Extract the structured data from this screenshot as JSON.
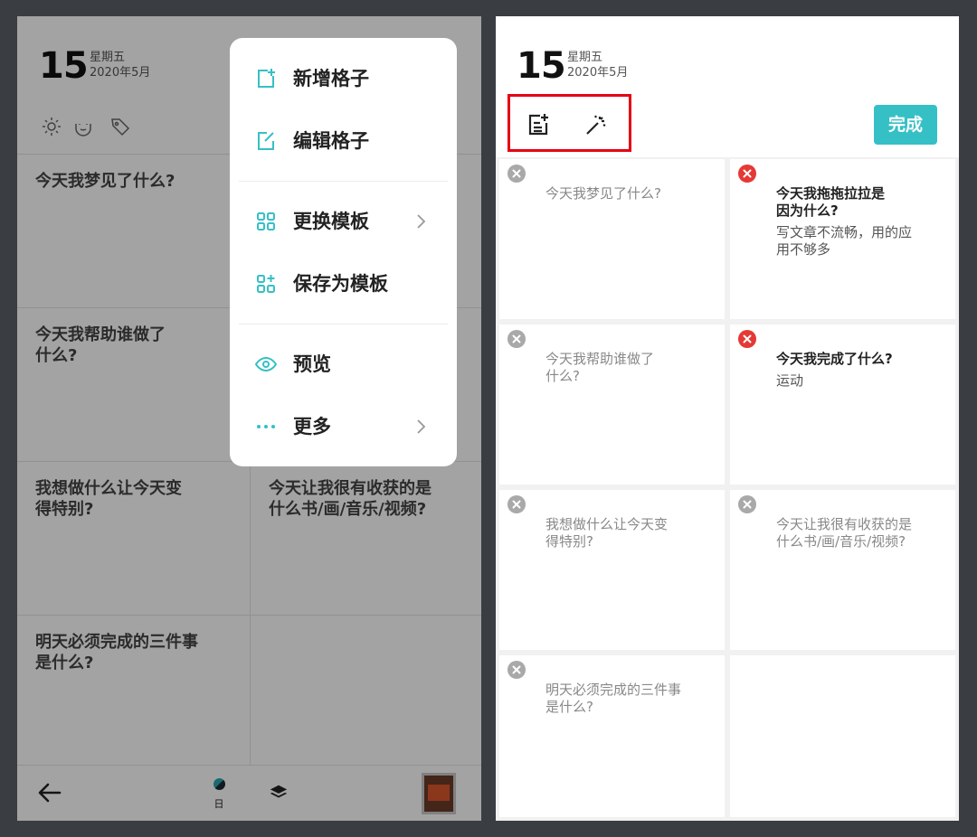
{
  "date": {
    "day": "15",
    "weekday": "星期五",
    "year_month": "2020年5月"
  },
  "left_panel": {
    "header_icons": [
      "sun-icon",
      "mood-icon",
      "tag-icon"
    ],
    "cells": [
      {
        "question_line1": "今天我梦见了什么?",
        "question_line2": ""
      },
      {
        "question_line1": "",
        "question_line2": ""
      },
      {
        "question_line1": "今天我帮助谁做了",
        "question_line2": "什么?"
      },
      {
        "question_line1": "",
        "question_line2": ""
      },
      {
        "question_line1": "我想做什么让今天变",
        "question_line2": "得特别?"
      },
      {
        "question_line1": "今天让我很有收获的是",
        "question_line2": "什么书/画/音乐/视频?"
      },
      {
        "question_line1": "明天必须完成的三件事",
        "question_line2": "是什么?"
      },
      {
        "question_line1": "",
        "question_line2": ""
      }
    ],
    "bottom_bar": {
      "back_icon": "arrow-left-icon",
      "day_label": "日",
      "layers_icon": "layers-icon"
    },
    "menu": {
      "items": [
        {
          "label": "新增格子",
          "icon": "add-cell-icon",
          "has_submenu": false
        },
        {
          "label": "编辑格子",
          "icon": "edit-cell-icon",
          "has_submenu": false
        },
        {
          "label": "更换模板",
          "icon": "template-grid-icon",
          "has_submenu": true
        },
        {
          "label": "保存为模板",
          "icon": "save-template-icon",
          "has_submenu": true
        },
        {
          "label": "预览",
          "icon": "eye-icon",
          "has_submenu": false
        },
        {
          "label": "更多",
          "icon": "more-dots-icon",
          "has_submenu": true
        }
      ]
    }
  },
  "right_panel": {
    "toolbar_icons": [
      "add-note-icon",
      "magic-wand-icon"
    ],
    "done_label": "完成",
    "cells": [
      {
        "question_line1": "今天我梦见了什么?",
        "question_line2": "",
        "answer_line1": "",
        "answer_line2": "",
        "filled": false
      },
      {
        "question_line1": "今天我拖拖拉拉是",
        "question_line2": "因为什么?",
        "answer_line1": "写文章不流畅，用的应",
        "answer_line2": "用不够多",
        "filled": true
      },
      {
        "question_line1": "今天我帮助谁做了",
        "question_line2": "什么?",
        "answer_line1": "",
        "answer_line2": "",
        "filled": false
      },
      {
        "question_line1": "今天我完成了什么?",
        "question_line2": "",
        "answer_line1": "运动",
        "answer_line2": "",
        "filled": true
      },
      {
        "question_line1": "我想做什么让今天变",
        "question_line2": "得特别?",
        "answer_line1": "",
        "answer_line2": "",
        "filled": false
      },
      {
        "question_line1": "今天让我很有收获的是",
        "question_line2": "什么书/画/音乐/视频?",
        "answer_line1": "",
        "answer_line2": "",
        "filled": false
      },
      {
        "question_line1": "明天必须完成的三件事",
        "question_line2": "是什么?",
        "answer_line1": "",
        "answer_line2": "",
        "filled": false
      }
    ]
  },
  "colors": {
    "accent": "#35c0c6",
    "highlight_border": "#e60012",
    "delete_red": "#e53935",
    "delete_grey": "#a9a9a9",
    "background": "#3a3d42"
  }
}
